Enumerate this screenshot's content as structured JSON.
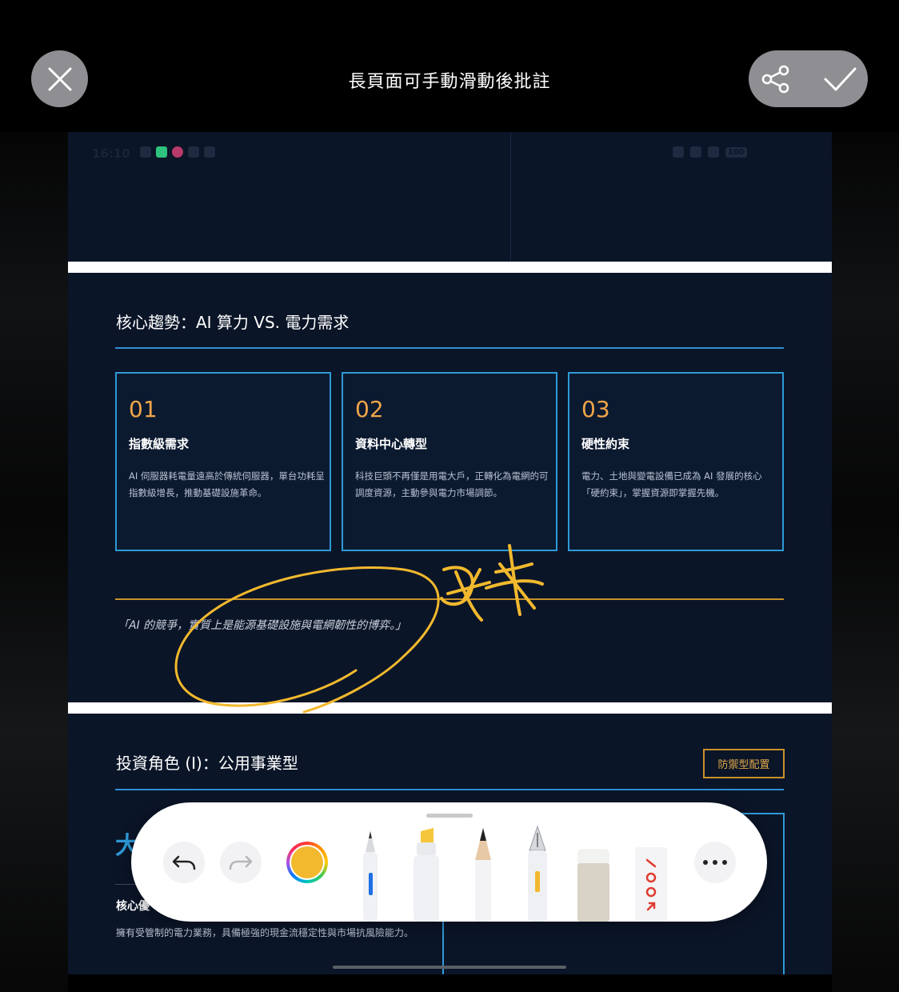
{
  "topbar": {
    "title": "長頁面可手動滑動後批註"
  },
  "status_bar": {
    "time": "16:10",
    "battery": "100"
  },
  "section1": {
    "title": "核心趨勢：AI 算力 VS. 電力需求",
    "cards": [
      {
        "num": "01",
        "title": "指數級需求",
        "body": "AI 伺服器耗電量遠高於傳統伺服器，單台功耗呈指數級增長，推動基礎設施革命。"
      },
      {
        "num": "02",
        "title": "資料中心轉型",
        "body": "科技巨頭不再僅是用電大戶，正轉化為電網的可調度資源，主動參與電力市場調節。"
      },
      {
        "num": "03",
        "title": "硬性約束",
        "body": "電力、土地與變電設備已成為 AI 發展的核心「硬約束」，掌握資源即掌握先機。"
      }
    ],
    "quote": "「AI 的競爭，實質上是能源基礎設施與電網韌性的博弈。」"
  },
  "section2": {
    "title": "投資角色 (I)：公用事業型",
    "tag": "防禦型配置",
    "big_char": "大",
    "core_label": "核心優",
    "body": "擁有受管制的電力業務，具備極強的現金流穩定性與市場抗風險能力。"
  },
  "toolbar": {
    "selected_color": "#f2b92e",
    "tools": [
      "undo-icon",
      "redo-icon",
      "color-picker",
      "pen",
      "highlighter",
      "pencil",
      "fountain-pen",
      "eraser",
      "lasso-ruler",
      "more-icon"
    ]
  },
  "colors": {
    "accent_blue": "#2e9ad8",
    "accent_gold": "#c7912b",
    "doc_bg": "#0b1528",
    "ink": "#f2b92e"
  }
}
